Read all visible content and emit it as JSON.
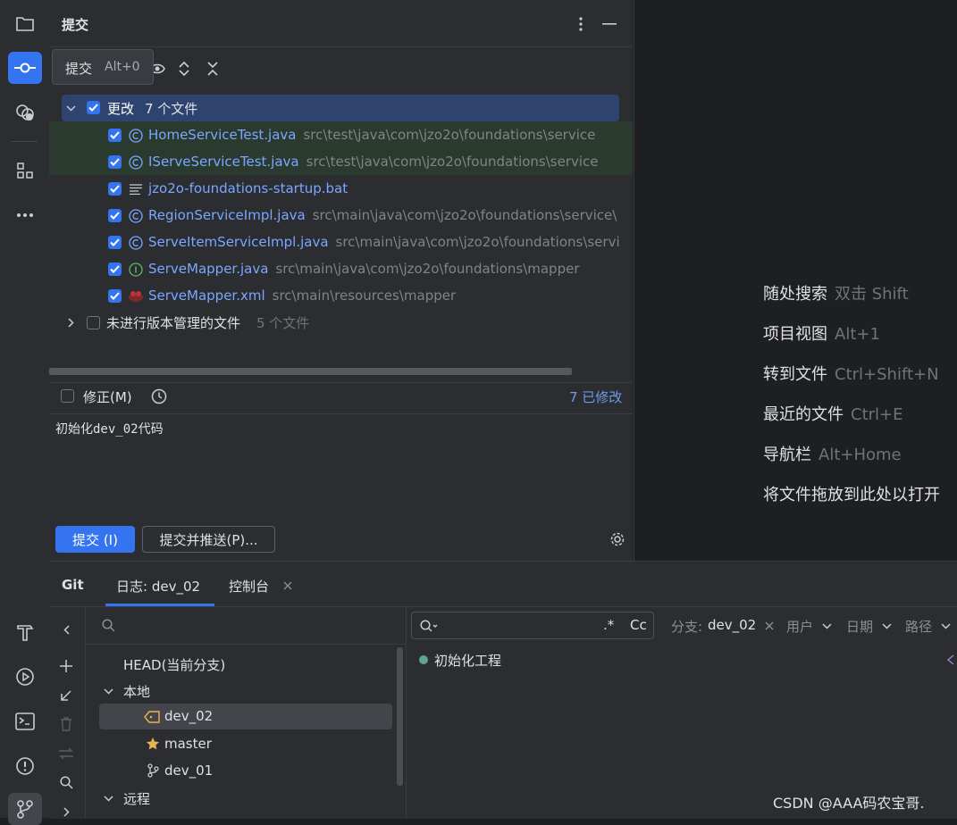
{
  "commit_panel": {
    "title": "提交",
    "tooltip": {
      "label": "提交",
      "shortcut": "Alt+0"
    },
    "changes_group": {
      "label": "更改",
      "count": "7 个文件"
    },
    "files": [
      {
        "name": "HomeServiceTest.java",
        "path": "src\\test\\java\\com\\jzo2o\\foundations\\service",
        "icon": "class-icon"
      },
      {
        "name": "IServeServiceTest.java",
        "path": "src\\test\\java\\com\\jzo2o\\foundations\\service",
        "icon": "class-icon"
      },
      {
        "name": "jzo2o-foundations-startup.bat",
        "path": "",
        "icon": "text-file-icon"
      },
      {
        "name": "RegionServiceImpl.java",
        "path": "src\\main\\java\\com\\jzo2o\\foundations\\service\\",
        "icon": "class-icon"
      },
      {
        "name": "ServeItemServiceImpl.java",
        "path": "src\\main\\java\\com\\jzo2o\\foundations\\servi",
        "icon": "class-icon"
      },
      {
        "name": "ServeMapper.java",
        "path": "src\\main\\java\\com\\jzo2o\\foundations\\mapper",
        "icon": "interface-icon"
      },
      {
        "name": "ServeMapper.xml",
        "path": "src\\main\\resources\\mapper",
        "icon": "mybatis-icon"
      }
    ],
    "unversioned": {
      "label": "未进行版本管理的文件",
      "count": "5 个文件"
    },
    "amend_label": "修正(M)",
    "modified_count": "7 已修改",
    "commit_message": "初始化dev_02代码",
    "commit_button": "提交 (I)",
    "commit_push_button": "提交并推送(P)..."
  },
  "empty_editor_hints": [
    {
      "label": "随处搜索",
      "key": "双击 Shift"
    },
    {
      "label": "项目视图",
      "key": "Alt+1"
    },
    {
      "label": "转到文件",
      "key": "Ctrl+Shift+N"
    },
    {
      "label": "最近的文件",
      "key": "Ctrl+E"
    },
    {
      "label": "导航栏",
      "key": "Alt+Home"
    },
    {
      "label": "将文件拖放到此处以打开",
      "key": ""
    }
  ],
  "git_panel": {
    "tabs": {
      "git": "Git",
      "log": "日志: dev_02",
      "console": "控制台"
    },
    "branches": {
      "head": "HEAD(当前分支)",
      "local_label": "本地",
      "local": [
        "dev_02",
        "master",
        "dev_01"
      ],
      "remote_label": "远程"
    },
    "filters": {
      "regex": ".*",
      "case": "Cc",
      "branch_label": "分支:",
      "branch_value": "dev_02",
      "user": "用户",
      "date": "日期",
      "path": "路径"
    },
    "commits": [
      {
        "message": "初始化工程"
      }
    ]
  },
  "watermark": "CSDN @AAA码农宝哥.",
  "colors": {
    "accent": "#3574f0",
    "selection": "#2e436e",
    "file_blue": "#7aa7ff",
    "muted": "#7f848b"
  }
}
